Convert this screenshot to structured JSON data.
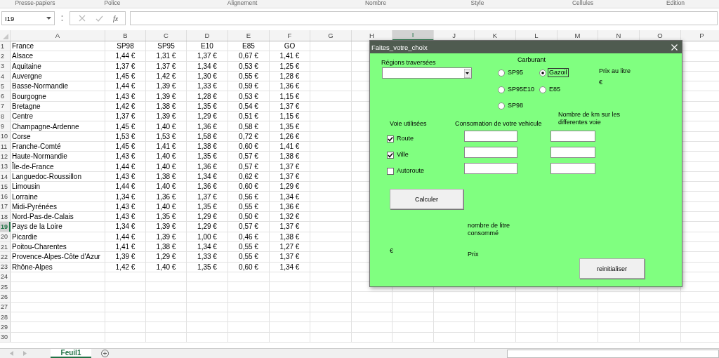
{
  "ribbon_groups": [
    "Presse-papiers",
    "Police",
    "Alignement",
    "Nombre",
    "Style",
    "Cellules",
    "Edition"
  ],
  "name_box": {
    "value": "I19"
  },
  "formula_bar": {
    "function_label": "fx"
  },
  "columns": [
    {
      "label": "A",
      "selected": false
    },
    {
      "label": "B",
      "selected": false
    },
    {
      "label": "C",
      "selected": false
    },
    {
      "label": "D",
      "selected": false
    },
    {
      "label": "E",
      "selected": false
    },
    {
      "label": "F",
      "selected": false
    },
    {
      "label": "G",
      "selected": false
    },
    {
      "label": "H",
      "selected": false
    },
    {
      "label": "I",
      "selected": true
    },
    {
      "label": "J",
      "selected": false
    },
    {
      "label": "K",
      "selected": false
    },
    {
      "label": "L",
      "selected": false
    },
    {
      "label": "M",
      "selected": false
    },
    {
      "label": "N",
      "selected": false
    },
    {
      "label": "O",
      "selected": false
    },
    {
      "label": "P",
      "selected": false
    }
  ],
  "row_numbers": [
    {
      "label": "1",
      "selected": false
    },
    {
      "label": "2",
      "selected": false
    },
    {
      "label": "3",
      "selected": false
    },
    {
      "label": "4",
      "selected": false
    },
    {
      "label": "5",
      "selected": false
    },
    {
      "label": "6",
      "selected": false
    },
    {
      "label": "7",
      "selected": false
    },
    {
      "label": "8",
      "selected": false
    },
    {
      "label": "9",
      "selected": false
    },
    {
      "label": "10",
      "selected": false
    },
    {
      "label": "11",
      "selected": false
    },
    {
      "label": "12",
      "selected": false
    },
    {
      "label": "13",
      "selected": false
    },
    {
      "label": "14",
      "selected": false
    },
    {
      "label": "15",
      "selected": false
    },
    {
      "label": "16",
      "selected": false
    },
    {
      "label": "17",
      "selected": false
    },
    {
      "label": "18",
      "selected": false
    },
    {
      "label": "19",
      "selected": true
    },
    {
      "label": "20",
      "selected": false
    },
    {
      "label": "21",
      "selected": false
    },
    {
      "label": "22",
      "selected": false
    },
    {
      "label": "23",
      "selected": false
    },
    {
      "label": "24",
      "selected": false
    },
    {
      "label": "25",
      "selected": false
    },
    {
      "label": "26",
      "selected": false
    },
    {
      "label": "27",
      "selected": false
    },
    {
      "label": "28",
      "selected": false
    },
    {
      "label": "29",
      "selected": false
    },
    {
      "label": "30",
      "selected": false
    }
  ],
  "rows": [
    [
      "France",
      "SP98",
      "SP95",
      "E10",
      "E85",
      "GO"
    ],
    [
      "Alsace",
      "1,44 €",
      "1,31 €",
      "1,37 €",
      "0,67 €",
      "1,41 €"
    ],
    [
      "Aquitaine",
      "1,37 €",
      "1,37 €",
      "1,34 €",
      "0,53 €",
      "1,25 €"
    ],
    [
      "Auvergne",
      "1,45 €",
      "1,42 €",
      "1,30 €",
      "0,55 €",
      "1,28 €"
    ],
    [
      "Basse-Normandie",
      "1,44 €",
      "1,39 €",
      "1,33 €",
      "0,59 €",
      "1,36 €"
    ],
    [
      "Bourgogne",
      "1,43 €",
      "1,39 €",
      "1,28 €",
      "0,53 €",
      "1,15 €"
    ],
    [
      "Bretagne",
      "1,42 €",
      "1,38 €",
      "1,35 €",
      "0,54 €",
      "1,37 €"
    ],
    [
      "Centre",
      "1,37 €",
      "1,39 €",
      "1,29 €",
      "0,51 €",
      "1,15 €"
    ],
    [
      "Champagne-Ardenne",
      "1,45 €",
      "1,40 €",
      "1,36 €",
      "0,58 €",
      "1,35 €"
    ],
    [
      "Corse",
      "1,53 €",
      "1,53 €",
      "1,58 €",
      "0,72 €",
      "1,26 €"
    ],
    [
      "Franche-Comté",
      "1,45 €",
      "1,41 €",
      "1,38 €",
      "0,60 €",
      "1,41 €"
    ],
    [
      "Haute-Normandie",
      "1,43 €",
      "1,40 €",
      "1,35 €",
      "0,57 €",
      "1,38 €"
    ],
    [
      "Île-de-France",
      "1,44 €",
      "1,40 €",
      "1,36 €",
      "0,57 €",
      "1,37 €"
    ],
    [
      "Languedoc-Roussillon",
      "1,43 €",
      "1,38 €",
      "1,34 €",
      "0,62 €",
      "1,37 €"
    ],
    [
      "Limousin",
      "1,44 €",
      "1,40 €",
      "1,36 €",
      "0,60 €",
      "1,29 €"
    ],
    [
      "Lorraine",
      "1,34 €",
      "1,36 €",
      "1,37 €",
      "0,56 €",
      "1,34 €"
    ],
    [
      "Midi-Pyrénées",
      "1,43 €",
      "1,40 €",
      "1,35 €",
      "0,55 €",
      "1,36 €"
    ],
    [
      "Nord-Pas-de-Calais",
      "1,43 €",
      "1,35 €",
      "1,29 €",
      "0,50 €",
      "1,32 €"
    ],
    [
      "Pays de la Loire",
      "1,34 €",
      "1,39 €",
      "1,29 €",
      "0,57 €",
      "1,37 €"
    ],
    [
      "Picardie",
      "1,44 €",
      "1,39 €",
      "1,00 €",
      "0,46 €",
      "1,38 €"
    ],
    [
      "Poitou-Charentes",
      "1,41 €",
      "1,38 €",
      "1,34 €",
      "0,55 €",
      "1,27 €"
    ],
    [
      "Provence-Alpes-Côte d'Azur",
      "1,39 €",
      "1,29 €",
      "1,33 €",
      "0,55 €",
      "1,37 €"
    ],
    [
      "Rhône-Alpes",
      "1,42 €",
      "1,40 €",
      "1,35 €",
      "0,60 €",
      "1,34 €"
    ]
  ],
  "dialog": {
    "title": "Faites_votre_choix",
    "fuel_label": "Carburant",
    "regions_label": "Régions traversées",
    "fuel_options": [
      {
        "label": "SP95",
        "selected": false
      },
      {
        "label": "Gazoil",
        "selected": true
      },
      {
        "label": "SP95E10",
        "selected": false
      },
      {
        "label": "E85",
        "selected": false
      },
      {
        "label": "SP98",
        "selected": false
      }
    ],
    "price_per_litre_label": "Prix au litre",
    "price_per_litre_unit": "€",
    "roads_label": "Voie utilisées",
    "consumption_label": "Consomation de votre vehicule",
    "km_label": "Nombre de km sur les differentes voie",
    "roads": [
      {
        "label": "Route",
        "checked": true
      },
      {
        "label": "Ville",
        "checked": true
      },
      {
        "label": "Autoroute",
        "checked": false
      }
    ],
    "calculate_button": "Calculer",
    "litres_label": "nombre de litre consommé",
    "price_unit": "€",
    "price_label": "Prix",
    "reset_button": "reinitialiser"
  },
  "sheet_tabs": [
    {
      "label": "Feuil1",
      "selected": true
    }
  ]
}
